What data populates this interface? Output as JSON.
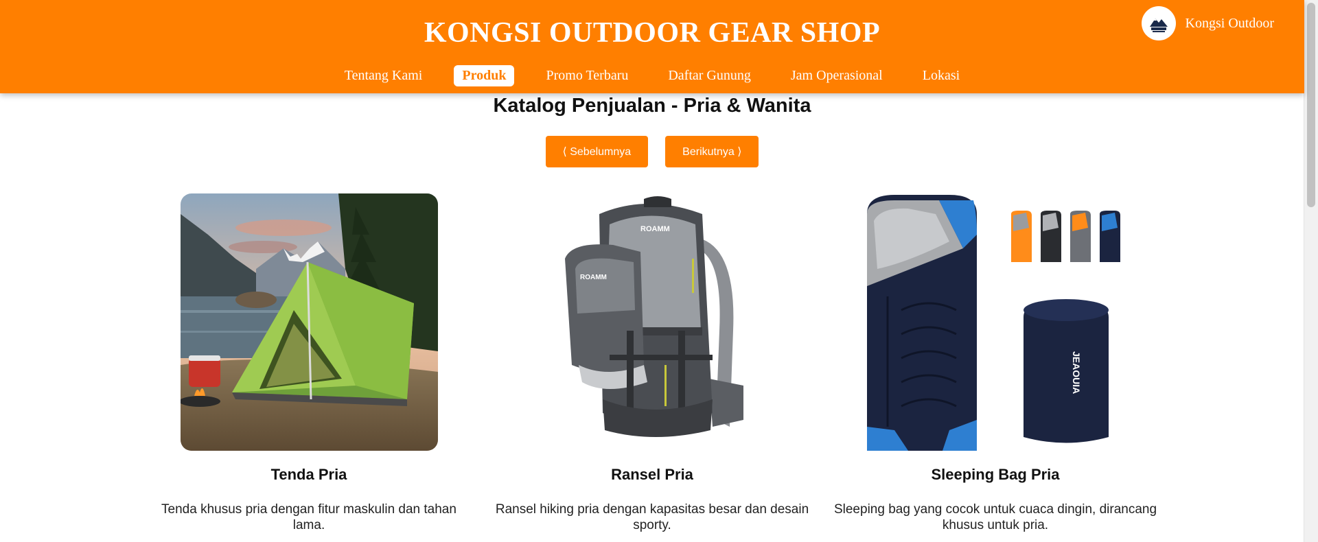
{
  "header": {
    "title": "KONGSI OUTDOOR GEAR SHOP",
    "brand_name": "Kongsi Outdoor",
    "brand_color": "#ff7f00",
    "nav": [
      {
        "label": "Tentang Kami",
        "active": false
      },
      {
        "label": "Produk",
        "active": true
      },
      {
        "label": "Promo Terbaru",
        "active": false
      },
      {
        "label": "Daftar Gunung",
        "active": false
      },
      {
        "label": "Jam Operasional",
        "active": false
      },
      {
        "label": "Lokasi",
        "active": false
      }
    ]
  },
  "catalog": {
    "title": "Katalog Penjualan - Pria & Wanita",
    "prev_label": "⟨ Sebelumnya",
    "next_label": "Berikutnya ⟩"
  },
  "products": [
    {
      "name": "Tenda Pria",
      "description": "Tenda khusus pria dengan fitur maskulin dan tahan lama.",
      "image_icon": "tent-photo"
    },
    {
      "name": "Ransel Pria",
      "description": "Ransel hiking pria dengan kapasitas besar dan desain sporty.",
      "image_icon": "backpack-photo"
    },
    {
      "name": "Sleeping Bag Pria",
      "description": "Sleeping bag yang cocok untuk cuaca dingin, dirancang khusus untuk pria.",
      "image_icon": "sleeping-bag-photo"
    }
  ]
}
